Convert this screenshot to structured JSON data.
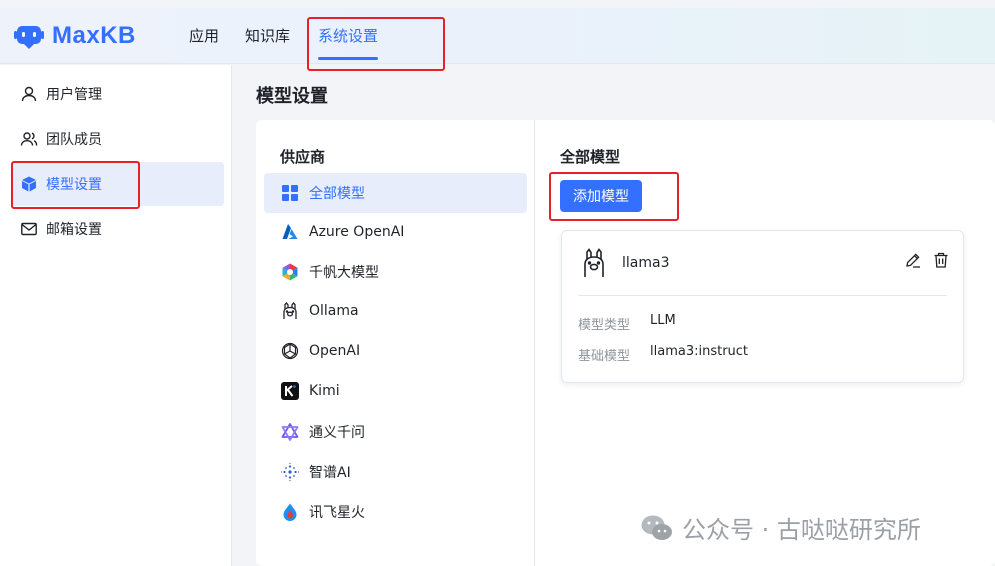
{
  "app": {
    "name": "MaxKB",
    "brand_color": "#3370ff"
  },
  "topnav": [
    {
      "label": "应用",
      "active": false
    },
    {
      "label": "知识库",
      "active": false
    },
    {
      "label": "系统设置",
      "active": true
    }
  ],
  "sidebar": {
    "items": [
      {
        "label": "用户管理",
        "icon": "user-icon",
        "active": false
      },
      {
        "label": "团队成员",
        "icon": "team-icon",
        "active": false
      },
      {
        "label": "模型设置",
        "icon": "cube-icon",
        "active": true
      },
      {
        "label": "邮箱设置",
        "icon": "mail-icon",
        "active": false
      }
    ]
  },
  "main": {
    "title": "模型设置",
    "providers_title": "供应商",
    "providers": [
      {
        "label": "全部模型",
        "icon": "grid-icon",
        "active": true
      },
      {
        "label": "Azure OpenAI",
        "icon": "azure-icon"
      },
      {
        "label": "千帆大模型",
        "icon": "qianfan-icon"
      },
      {
        "label": "Ollama",
        "icon": "ollama-icon"
      },
      {
        "label": "OpenAI",
        "icon": "openai-icon"
      },
      {
        "label": "Kimi",
        "icon": "kimi-icon"
      },
      {
        "label": "通义千问",
        "icon": "tongyi-icon"
      },
      {
        "label": "智谱AI",
        "icon": "zhipu-icon"
      },
      {
        "label": "讯飞星火",
        "icon": "xunfei-icon"
      }
    ],
    "models_title": "全部模型",
    "add_button": "添加模型",
    "model_card": {
      "name": "llama3",
      "icon": "ollama-icon",
      "type_label": "模型类型",
      "type_value": "LLM",
      "base_label": "基础模型",
      "base_value": "llama3:instruct"
    }
  },
  "watermark": {
    "text": "公众号 · 古哒哒研究所"
  }
}
